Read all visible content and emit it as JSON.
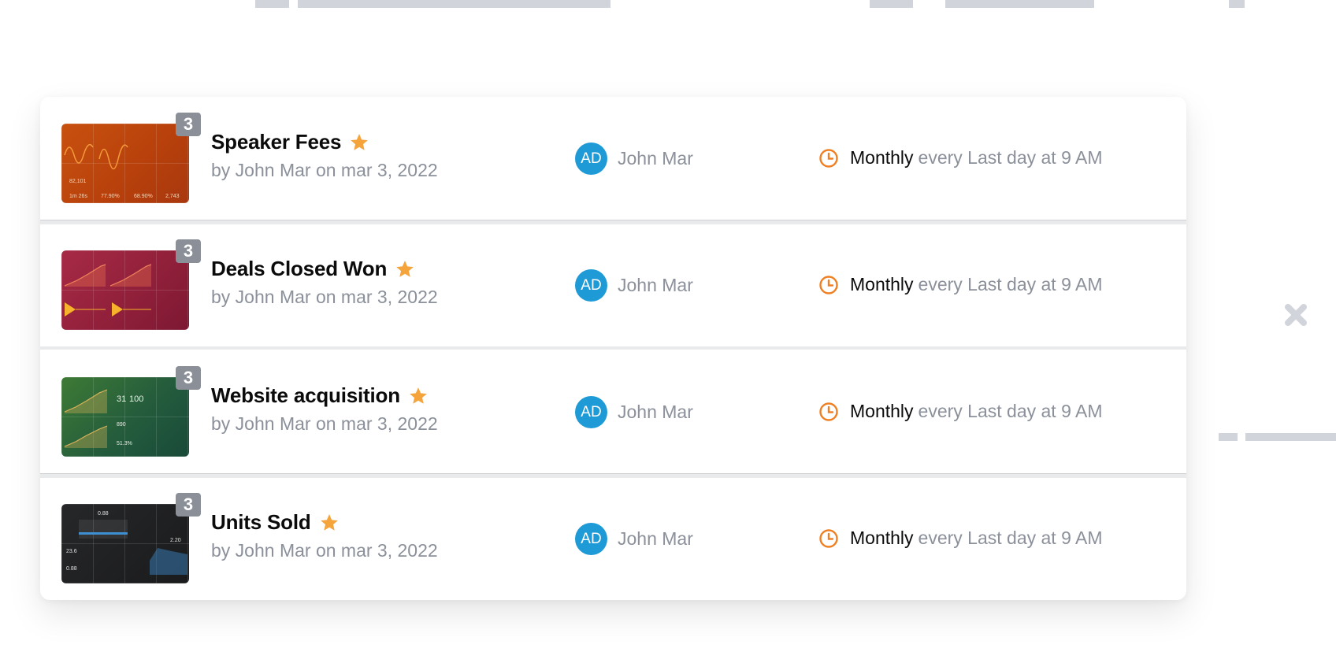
{
  "reports": [
    {
      "title": "Speaker Fees",
      "subtitle": "by John Mar on mar 3, 2022",
      "badge_count": "3",
      "starred": true,
      "thumbnail_theme": "orange",
      "owner_initials": "AD",
      "owner_name": "John Mar",
      "frequency": "Monthly",
      "schedule_detail": "every Last day at 9 AM"
    },
    {
      "title": "Deals Closed Won",
      "subtitle": "by John Mar on mar 3, 2022",
      "badge_count": "3",
      "starred": true,
      "thumbnail_theme": "crimson",
      "owner_initials": "AD",
      "owner_name": "John Mar",
      "frequency": "Monthly",
      "schedule_detail": "every Last day at 9 AM"
    },
    {
      "title": "Website acquisition",
      "subtitle": "by John Mar on mar 3, 2022",
      "badge_count": "3",
      "starred": true,
      "thumbnail_theme": "green",
      "owner_initials": "AD",
      "owner_name": "John Mar",
      "frequency": "Monthly",
      "schedule_detail": "every Last day at 9 AM"
    },
    {
      "title": "Units Sold",
      "subtitle": "by John Mar on mar 3, 2022",
      "badge_count": "3",
      "starred": true,
      "thumbnail_theme": "dark",
      "owner_initials": "AD",
      "owner_name": "John Mar",
      "frequency": "Monthly",
      "schedule_detail": "every Last day at 9 AM"
    }
  ],
  "icons": {
    "star": "star-icon",
    "clock": "clock-icon",
    "close": "close-icon"
  },
  "colors": {
    "star": "#f5a33b",
    "clock": "#f07f22",
    "avatar": "#1e9ad6",
    "badge": "#8a8f98",
    "muted_text": "#8b909a",
    "close_icon": "#d1d5db"
  }
}
